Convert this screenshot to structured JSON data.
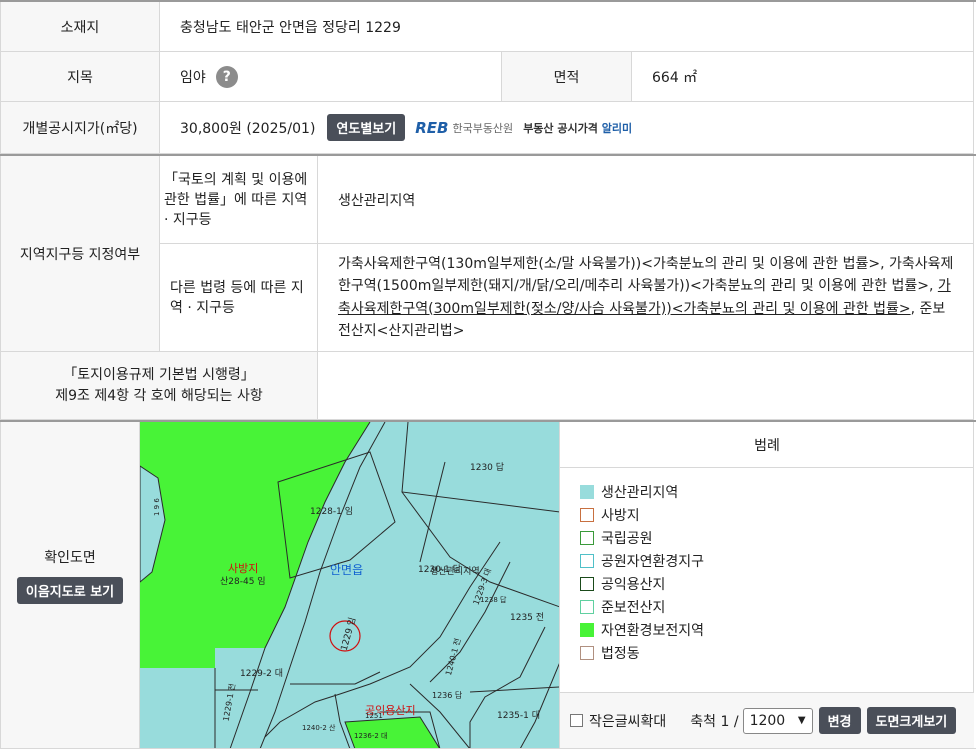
{
  "rows": {
    "location": {
      "label": "소재지",
      "value": "충청남도 태안군 안면읍 정당리 1229"
    },
    "land": {
      "label": "지목",
      "value": "임야",
      "help_icon": "?",
      "area_label": "면적",
      "area_value": "664 ㎡"
    },
    "price": {
      "label": "개별공시지가(㎡당)",
      "value": "30,800원 (2025/01)",
      "yearly_button": "연도별보기",
      "reb_logo": "REB",
      "reb_name": "한국부동산원",
      "reb_service_prefix": "부동산 공시가격",
      "reb_service_suffix": "알리미"
    },
    "zoning": {
      "label": "지역지구등 지정여부",
      "sub1_label": "「국토의 계획 및 이용에 관한 법률」에 따른 지역 · 지구등",
      "sub1_value": "생산관리지역",
      "sub2_label": "다른 법령 등에 따른 지역 · 지구등",
      "sub2_text1": "가축사육제한구역(130m일부제한(소/말 사육불가))<가축분뇨의 관리 및 이용에 관한 법률>, 가축사육제한구역(1500m일부제한(돼지/개/닭/오리/메추리 사육불가))<가축분뇨의 관리 및 이용에 관한 법률>, ",
      "sub2_link": "가축사육제한구역(300m일부제한(젖소/양/사슴 사육불가))<가축분뇨의 관리 및 이용에 관한 법률>",
      "sub2_text2": ", 준보전산지<산지관리법>"
    },
    "regulation": {
      "label_line1": "「토지이용규제 기본법 시행령」",
      "label_line2": "제9조 제4항 각 호에 해당되는 사항",
      "value": ""
    }
  },
  "map_section": {
    "label": "확인도면",
    "button": "이음지도로 보기",
    "labels": {
      "p1230": "1230 답",
      "p1228_1": "1228-1 임",
      "p1229": "1229 임",
      "sabangji": "사방지",
      "p28_45": "산28-45 임",
      "anmyeon": "안면읍",
      "p1230_1": "1230-1 답",
      "saengsan": "생산관리지역",
      "p1235": "1235 전",
      "p1229_2": "1229-2 대",
      "p1229_3": "1229-3 대",
      "p1229_1": "1229-1 전",
      "p1236": "1236 답",
      "p1235_1": "1235-1 대",
      "p1240_1": "1240-1 전",
      "p1240_2": "1240-2 산",
      "gongik": "공익용산지",
      "p1236_2": "1236-2 대",
      "left_num": "1 9 6",
      "p1251": "1251",
      "p1238": "1238 답"
    },
    "colors": {
      "green": "#48f337",
      "cyan": "#98dcdc",
      "parcel_line": "#2a2a2a",
      "zone_line": "#d01010"
    }
  },
  "legend": {
    "title": "범례",
    "items": [
      {
        "label": "생산관리지역",
        "fill": "#98dcdc",
        "border": "#98dcdc"
      },
      {
        "label": "사방지",
        "fill": "#ffffff",
        "border": "#c87040"
      },
      {
        "label": "국립공원",
        "fill": "#ffffff",
        "border": "#3a9a3a"
      },
      {
        "label": "공원자연환경지구",
        "fill": "#ffffff",
        "border": "#50c0c8"
      },
      {
        "label": "공익용산지",
        "fill": "#ffffff",
        "border": "#1a4a1a"
      },
      {
        "label": "준보전산지",
        "fill": "#ffffff",
        "border": "#60d0a0"
      },
      {
        "label": "자연환경보전지역",
        "fill": "#48f337",
        "border": "#48f337"
      },
      {
        "label": "법정동",
        "fill": "#ffffff",
        "border": "#b09080"
      }
    ]
  },
  "controls": {
    "small_text_label": "작은글씨확대",
    "scale_label": "축척 1 /",
    "scale_value": "1200",
    "change_button": "변경",
    "big_view_button": "도면크게보기"
  }
}
